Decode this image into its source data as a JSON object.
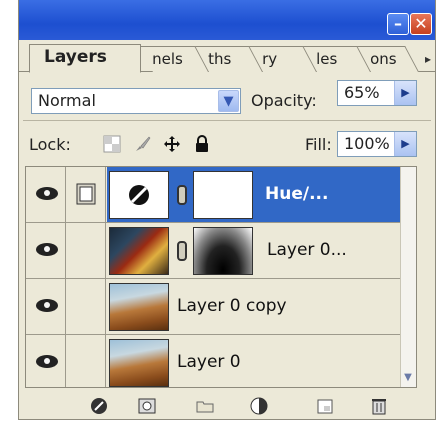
{
  "window": {
    "minimize_icon": "minimize-icon",
    "close_icon": "close-icon",
    "minimize_glyph": "–",
    "close_glyph": "✕"
  },
  "tabs": [
    {
      "label": "Layers",
      "active": true
    },
    {
      "label": "nels"
    },
    {
      "label": "ths"
    },
    {
      "label": "ry"
    },
    {
      "label": "les"
    },
    {
      "label": "ons"
    }
  ],
  "tab_menu_glyph": "▸",
  "blend": {
    "mode": "Normal",
    "opacity_label": "Opacity:",
    "opacity_value": "65%"
  },
  "lock": {
    "label": "Lock:",
    "fill_label": "Fill:",
    "fill_value": "100%"
  },
  "layers": [
    {
      "name": "Hue/...",
      "selected": true,
      "type": "adjustment"
    },
    {
      "name": "Layer 0...",
      "selected": false,
      "type": "masked"
    },
    {
      "name": "Layer 0 copy",
      "selected": false,
      "type": "image"
    },
    {
      "name": "Layer 0",
      "selected": false,
      "type": "image"
    }
  ],
  "colors": {
    "titlebar": "#1d4fd0",
    "panel_bg": "#ece9d8",
    "selected_row": "#3168c6"
  },
  "footer_icons": [
    "link-layers-icon",
    "layer-mask-icon",
    "new-group-icon",
    "adjustment-layer-icon",
    "new-layer-icon",
    "trash-icon"
  ]
}
